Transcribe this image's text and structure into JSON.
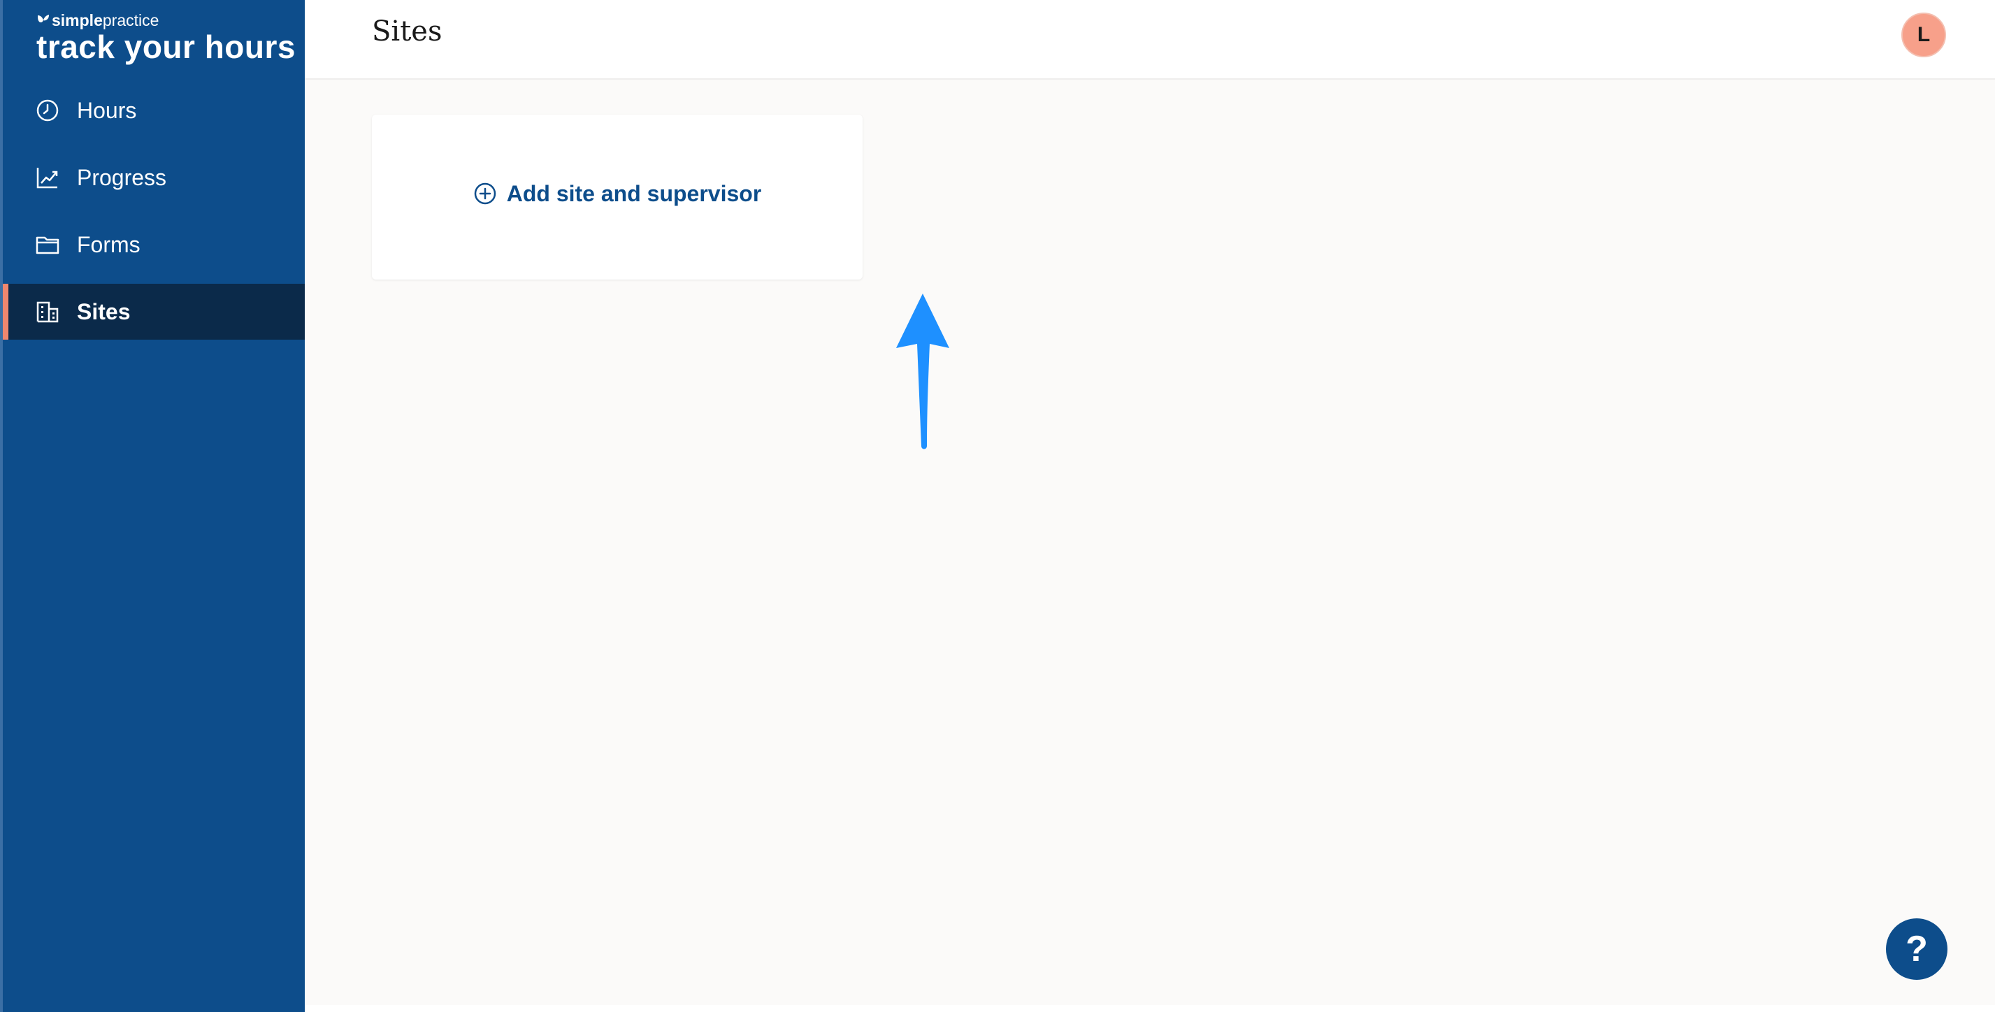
{
  "brand": {
    "logo_bold": "simple",
    "logo_regular": "practice",
    "title": "track your hours"
  },
  "sidebar": {
    "items": [
      {
        "label": "Hours",
        "icon": "clock-icon",
        "active": false
      },
      {
        "label": "Progress",
        "icon": "chart-line-icon",
        "active": false
      },
      {
        "label": "Forms",
        "icon": "folder-icon",
        "active": false
      },
      {
        "label": "Sites",
        "icon": "building-icon",
        "active": true
      }
    ]
  },
  "header": {
    "title": "Sites",
    "avatar_initial": "L"
  },
  "main": {
    "add_card_label": "Add site and supervisor"
  },
  "help": {
    "label": "?"
  },
  "colors": {
    "sidebar_bg": "#0d4d8b",
    "active_bg": "#0b2a4a",
    "active_accent": "#f0876e",
    "avatar_bg": "#f7a08a",
    "link_color": "#0d4d8b",
    "annotation_arrow": "#1e90ff"
  }
}
